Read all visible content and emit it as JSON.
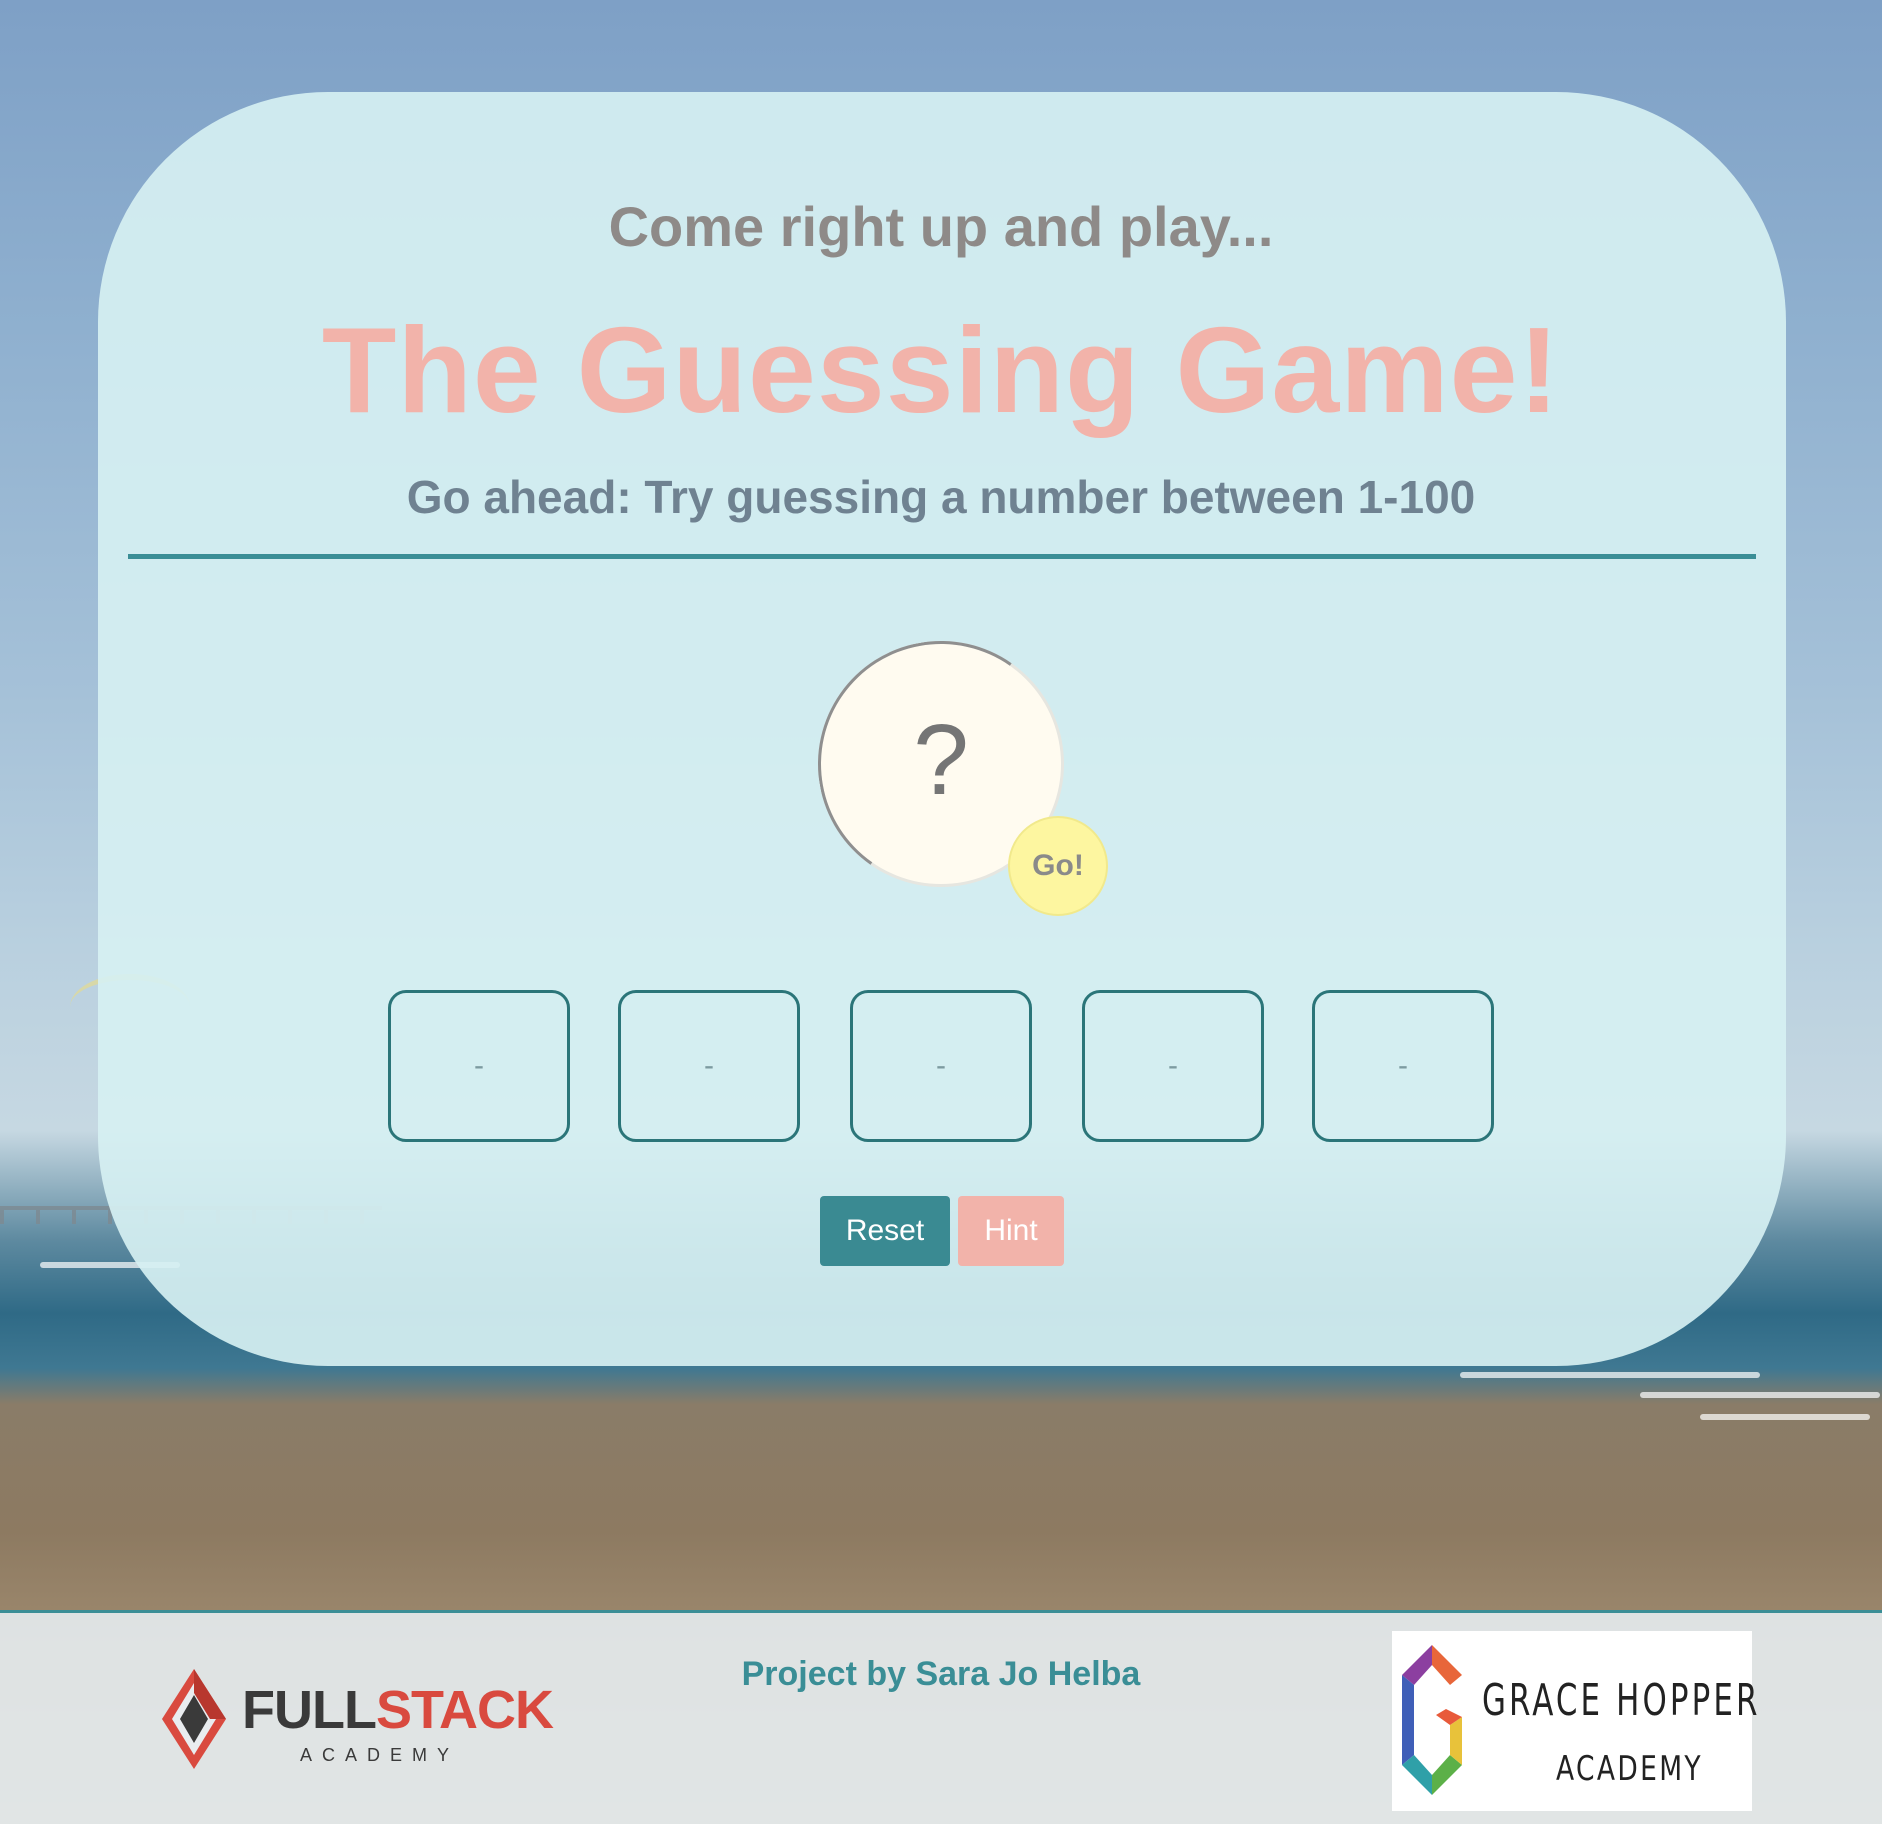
{
  "header": {
    "subtitle": "Come right up and play...",
    "title": "The Guessing Game!",
    "instructions": "Go ahead: Try guessing a number between 1-100"
  },
  "guess": {
    "placeholder": "?",
    "value": "",
    "go_label": "Go!"
  },
  "previous_guesses": [
    "-",
    "-",
    "-",
    "-",
    "-"
  ],
  "buttons": {
    "reset_label": "Reset",
    "hint_label": "Hint"
  },
  "footer": {
    "credit": "Project by Sara Jo Helba",
    "fullstack_logo": {
      "word_part1": "FULL",
      "word_part2": "STACK",
      "subtitle": "ACADEMY"
    },
    "gracehopper_logo": {
      "line1": "GRACE HOPPER",
      "line2": "ACADEMY"
    }
  },
  "colors": {
    "accent_teal": "#3a8a92",
    "title_pink": "#f2b3aa",
    "go_yellow": "#fdf6a0",
    "card_bg": "#d6f0f2"
  }
}
